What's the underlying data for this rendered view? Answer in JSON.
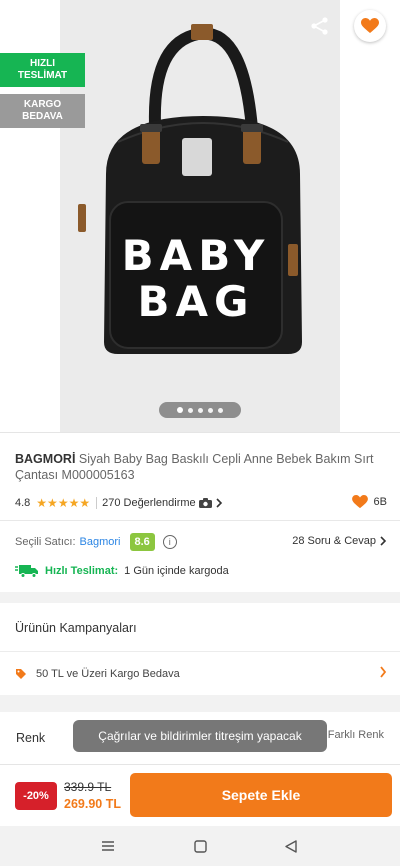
{
  "badges": {
    "fast_delivery": "HIZLI TESLİMAT",
    "free_cargo": "KARGO BEDAVA"
  },
  "bag_print": {
    "line1": "BABY",
    "line2": "BAG"
  },
  "carousel": {
    "count": 5,
    "active_index": 0
  },
  "product": {
    "brand": "BAGMORİ",
    "name": "Siyah Baby Bag Baskılı Cepli Anne Bebek Bakım Sırt Çantası M000005163",
    "rating": "4.8",
    "stars": "★★★★★",
    "reviews": "270 Değerlendirme",
    "favorites": "6B"
  },
  "seller": {
    "label": "Seçili Satıcı:",
    "name": "Bagmori",
    "score": "8.6",
    "qa": "28 Soru & Cevap"
  },
  "delivery": {
    "fast_label": "Hızlı Teslimat:",
    "text": "1 Gün içinde kargoda"
  },
  "campaign": {
    "title": "Ürünün Kampanyaları",
    "item": "50 TL ve Üzeri Kargo Bedava"
  },
  "color": {
    "label": "Renk",
    "more": "Farklı Renk"
  },
  "toast": {
    "text": "Çağrılar ve bildirimler titreşim yapacak"
  },
  "price": {
    "discount": "-20%",
    "old": "339.9 TL",
    "new": "269.90 TL",
    "cta": "Sepete Ekle"
  },
  "colors": {
    "accent": "#f27a1a",
    "green": "#16b553",
    "discount_red": "#d6202a",
    "seller_blue": "#2b85e4",
    "score_green": "#8cc63f"
  }
}
